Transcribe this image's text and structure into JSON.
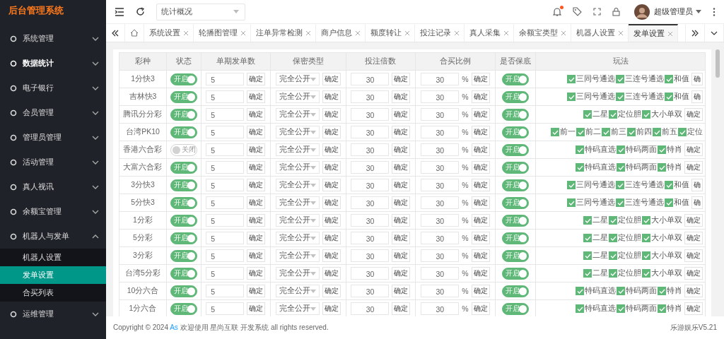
{
  "sidebar": {
    "logo": "后台管理系统",
    "items": [
      {
        "label": "系统管理",
        "active": false,
        "expanded": false
      },
      {
        "label": "数据统计",
        "active": true,
        "expanded": false
      },
      {
        "label": "电子银行",
        "active": false,
        "expanded": false
      },
      {
        "label": "会员管理",
        "active": false,
        "expanded": false
      },
      {
        "label": "管理员管理",
        "active": false,
        "expanded": false
      },
      {
        "label": "活动管理",
        "active": false,
        "expanded": false
      },
      {
        "label": "真人视讯",
        "active": false,
        "expanded": false
      },
      {
        "label": "余额宝管理",
        "active": false,
        "expanded": false
      },
      {
        "label": "机器人与发单",
        "active": false,
        "expanded": true,
        "children": [
          {
            "label": "机器人设置",
            "selected": false
          },
          {
            "label": "发单设置",
            "selected": true
          },
          {
            "label": "合买列表",
            "selected": false
          }
        ]
      },
      {
        "label": "运维管理",
        "active": false,
        "expanded": false
      }
    ]
  },
  "header": {
    "page_select": "统计概况",
    "notification_dot": true,
    "user": "超级管理员"
  },
  "tabs": [
    {
      "label": "系统设置",
      "selected": false
    },
    {
      "label": "轮播图管理",
      "selected": false
    },
    {
      "label": "注单异常检测",
      "selected": false
    },
    {
      "label": "商户信息",
      "selected": false
    },
    {
      "label": "额度转让",
      "selected": false
    },
    {
      "label": "投注记录",
      "selected": false
    },
    {
      "label": "真人采集",
      "selected": false
    },
    {
      "label": "余额宝类型",
      "selected": false
    },
    {
      "label": "机器人设置",
      "selected": false
    },
    {
      "label": "发单设置",
      "selected": true
    }
  ],
  "table": {
    "columns": [
      "彩种",
      "状态",
      "单期发单数",
      "保密类型",
      "投注倍数",
      "合买比例",
      "是否保底",
      "玩法"
    ],
    "rows": [
      {
        "name": "1分快3",
        "status": {
          "on": true,
          "label": "开启"
        },
        "count": "5",
        "count_button": "确定",
        "secrecy": "完全公开",
        "secrecy_button": "确定",
        "multiple": "30",
        "multiple_button": "确定",
        "ratio": "30",
        "ratio_unit": "%",
        "ratio_button": "确定",
        "guarantee": {
          "on": true,
          "label": "开启"
        },
        "plays": [
          {
            "label": "三同号通选",
            "checked": true
          },
          {
            "label": "三连号通选",
            "checked": true
          },
          {
            "label": "和值",
            "checked": true
          }
        ],
        "plays_button": "确"
      },
      {
        "name": "吉林快3",
        "status": {
          "on": true,
          "label": "开启"
        },
        "count": "5",
        "count_button": "确定",
        "secrecy": "完全公开",
        "secrecy_button": "确定",
        "multiple": "30",
        "multiple_button": "确定",
        "ratio": "30",
        "ratio_unit": "%",
        "ratio_button": "确定",
        "guarantee": {
          "on": true,
          "label": "开启"
        },
        "plays": [
          {
            "label": "三同号通选",
            "checked": true
          },
          {
            "label": "三连号通选",
            "checked": true
          },
          {
            "label": "和值",
            "checked": true
          }
        ],
        "plays_button": "确"
      },
      {
        "name": "腾讯分分彩",
        "status": {
          "on": true,
          "label": "开启"
        },
        "count": "5",
        "count_button": "确定",
        "secrecy": "完全公开",
        "secrecy_button": "确定",
        "multiple": "30",
        "multiple_button": "确定",
        "ratio": "30",
        "ratio_unit": "%",
        "ratio_button": "确定",
        "guarantee": {
          "on": true,
          "label": "开启"
        },
        "plays": [
          {
            "label": "二星",
            "checked": true
          },
          {
            "label": "定位胆",
            "checked": true
          },
          {
            "label": "大小单双",
            "checked": true
          }
        ],
        "plays_button": "确定"
      },
      {
        "name": "台湾PK10",
        "status": {
          "on": true,
          "label": "开启"
        },
        "count": "5",
        "count_button": "确定",
        "secrecy": "完全公开",
        "secrecy_button": "确定",
        "multiple": "30",
        "multiple_button": "确定",
        "ratio": "30",
        "ratio_unit": "%",
        "ratio_button": "确定",
        "guarantee": {
          "on": true,
          "label": "开启"
        },
        "plays": [
          {
            "label": "前一",
            "checked": true
          },
          {
            "label": "前二",
            "checked": true
          },
          {
            "label": "前三",
            "checked": true
          },
          {
            "label": "前四",
            "checked": true
          },
          {
            "label": "前五",
            "checked": true
          },
          {
            "label": "定位",
            "checked": true
          }
        ]
      },
      {
        "name": "香港六合彩",
        "status": {
          "on": false,
          "label": "关闭"
        },
        "count": "5",
        "count_button": "确定",
        "secrecy": "完全公开",
        "secrecy_button": "确定",
        "multiple": "30",
        "multiple_button": "确定",
        "ratio": "30",
        "ratio_unit": "%",
        "ratio_button": "确定",
        "guarantee": {
          "on": true,
          "label": "开启"
        },
        "plays": [
          {
            "label": "特码直选",
            "checked": true
          },
          {
            "label": "特码两面",
            "checked": true
          },
          {
            "label": "特肖",
            "checked": true
          }
        ],
        "plays_button": "确定"
      },
      {
        "name": "大富六合彩",
        "status": {
          "on": true,
          "label": "开启"
        },
        "count": "5",
        "count_button": "确定",
        "secrecy": "完全公开",
        "secrecy_button": "确定",
        "multiple": "30",
        "multiple_button": "确定",
        "ratio": "30",
        "ratio_unit": "%",
        "ratio_button": "确定",
        "guarantee": {
          "on": true,
          "label": "开启"
        },
        "plays": [
          {
            "label": "特码直选",
            "checked": true
          },
          {
            "label": "特码两面",
            "checked": true
          },
          {
            "label": "特肖",
            "checked": true
          }
        ],
        "plays_button": "确定"
      },
      {
        "name": "3分快3",
        "status": {
          "on": true,
          "label": "开启"
        },
        "count": "5",
        "count_button": "确定",
        "secrecy": "完全公开",
        "secrecy_button": "确定",
        "multiple": "30",
        "multiple_button": "确定",
        "ratio": "30",
        "ratio_unit": "%",
        "ratio_button": "确定",
        "guarantee": {
          "on": true,
          "label": "开启"
        },
        "plays": [
          {
            "label": "三同号通选",
            "checked": true
          },
          {
            "label": "三连号通选",
            "checked": true
          },
          {
            "label": "和值",
            "checked": true
          }
        ],
        "plays_button": "确"
      },
      {
        "name": "5分快3",
        "status": {
          "on": true,
          "label": "开启"
        },
        "count": "5",
        "count_button": "确定",
        "secrecy": "完全公开",
        "secrecy_button": "确定",
        "multiple": "30",
        "multiple_button": "确定",
        "ratio": "30",
        "ratio_unit": "%",
        "ratio_button": "确定",
        "guarantee": {
          "on": true,
          "label": "开启"
        },
        "plays": [
          {
            "label": "三同号通选",
            "checked": true
          },
          {
            "label": "三连号通选",
            "checked": true
          },
          {
            "label": "和值",
            "checked": true
          }
        ],
        "plays_button": "确"
      },
      {
        "name": "1分彩",
        "status": {
          "on": true,
          "label": "开启"
        },
        "count": "5",
        "count_button": "确定",
        "secrecy": "完全公开",
        "secrecy_button": "确定",
        "multiple": "30",
        "multiple_button": "确定",
        "ratio": "30",
        "ratio_unit": "%",
        "ratio_button": "确定",
        "guarantee": {
          "on": true,
          "label": "开启"
        },
        "plays": [
          {
            "label": "二星",
            "checked": true
          },
          {
            "label": "定位胆",
            "checked": true
          },
          {
            "label": "大小单双",
            "checked": true
          }
        ],
        "plays_button": "确定"
      },
      {
        "name": "5分彩",
        "status": {
          "on": true,
          "label": "开启"
        },
        "count": "5",
        "count_button": "确定",
        "secrecy": "完全公开",
        "secrecy_button": "确定",
        "multiple": "30",
        "multiple_button": "确定",
        "ratio": "30",
        "ratio_unit": "%",
        "ratio_button": "确定",
        "guarantee": {
          "on": true,
          "label": "开启"
        },
        "plays": [
          {
            "label": "二星",
            "checked": true
          },
          {
            "label": "定位胆",
            "checked": true
          },
          {
            "label": "大小单双",
            "checked": true
          }
        ],
        "plays_button": "确定"
      },
      {
        "name": "3分彩",
        "status": {
          "on": true,
          "label": "开启"
        },
        "count": "5",
        "count_button": "确定",
        "secrecy": "完全公开",
        "secrecy_button": "确定",
        "multiple": "30",
        "multiple_button": "确定",
        "ratio": "30",
        "ratio_unit": "%",
        "ratio_button": "确定",
        "guarantee": {
          "on": true,
          "label": "开启"
        },
        "plays": [
          {
            "label": "二星",
            "checked": true
          },
          {
            "label": "定位胆",
            "checked": true
          },
          {
            "label": "大小单双",
            "checked": true
          }
        ],
        "plays_button": "确定"
      },
      {
        "name": "台湾5分彩",
        "status": {
          "on": true,
          "label": "开启"
        },
        "count": "5",
        "count_button": "确定",
        "secrecy": "完全公开",
        "secrecy_button": "确定",
        "multiple": "30",
        "multiple_button": "确定",
        "ratio": "30",
        "ratio_unit": "%",
        "ratio_button": "确定",
        "guarantee": {
          "on": true,
          "label": "开启"
        },
        "plays": [
          {
            "label": "二星",
            "checked": true
          },
          {
            "label": "定位胆",
            "checked": true
          },
          {
            "label": "大小单双",
            "checked": true
          }
        ],
        "plays_button": "确定"
      },
      {
        "name": "10分六合",
        "status": {
          "on": true,
          "label": "开启"
        },
        "count": "5",
        "count_button": "确定",
        "secrecy": "完全公开",
        "secrecy_button": "确定",
        "multiple": "30",
        "multiple_button": "确定",
        "ratio": "30",
        "ratio_unit": "%",
        "ratio_button": "确定",
        "guarantee": {
          "on": true,
          "label": "开启"
        },
        "plays": [
          {
            "label": "特码直选",
            "checked": true
          },
          {
            "label": "特码两面",
            "checked": true
          },
          {
            "label": "特肖",
            "checked": true
          }
        ],
        "plays_button": "确定"
      },
      {
        "name": "1分六合",
        "status": {
          "on": true,
          "label": "开启"
        },
        "count": "5",
        "count_button": "确定",
        "secrecy": "完全公开",
        "secrecy_button": "确定",
        "multiple": "30",
        "multiple_button": "确定",
        "ratio": "30",
        "ratio_unit": "%",
        "ratio_button": "确定",
        "guarantee": {
          "on": true,
          "label": "开启"
        },
        "plays": [
          {
            "label": "特码直选",
            "checked": true
          },
          {
            "label": "特码两面",
            "checked": true
          },
          {
            "label": "特肖",
            "checked": true
          }
        ],
        "plays_button": "确定"
      }
    ]
  },
  "footer": {
    "copyright_prefix": "Copyright © 2024",
    "copyright_link": "As",
    "copyright_suffix": "欢迎使用 星尚互联 开发系统 all rights reserved.",
    "version": "乐游娱乐V5.21"
  }
}
